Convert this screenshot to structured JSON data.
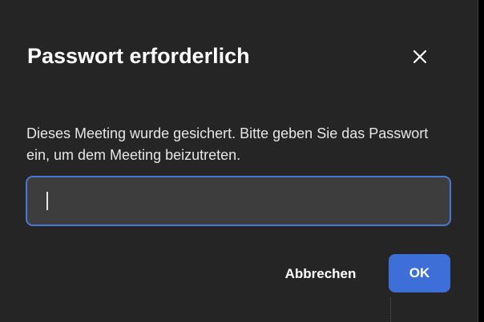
{
  "dialog": {
    "title": "Passwort erforderlich",
    "close_icon": "close-icon",
    "description": "Dieses Meeting wurde gesichert. Bitte geben Sie das Passwort ein, um dem Meeting beizutreten.",
    "password_input": {
      "value": "",
      "placeholder": ""
    },
    "cancel_label": "Abbrechen",
    "ok_label": "OK"
  },
  "colors": {
    "background": "#252525",
    "accent": "#3e6fd8",
    "input_border": "#4a78d6",
    "input_background": "#3d3d3d"
  }
}
